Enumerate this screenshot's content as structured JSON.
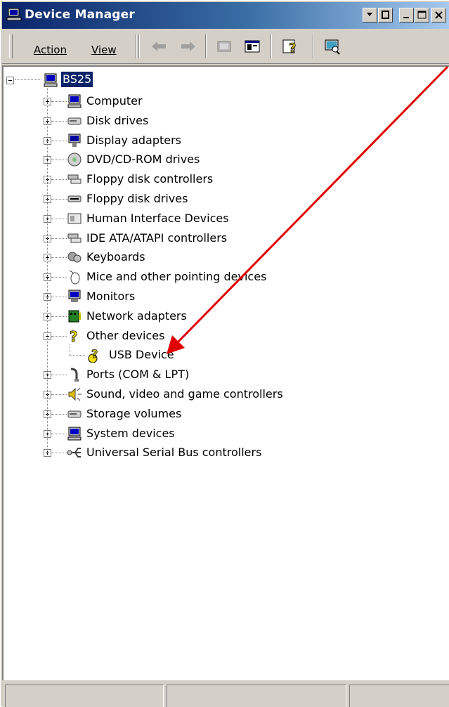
{
  "window": {
    "title": "Device Manager"
  },
  "menu": {
    "action": "Action",
    "view": "View"
  },
  "tree": {
    "root": "BS25",
    "items": [
      {
        "label": "Computer",
        "icon": "computer-icon"
      },
      {
        "label": "Disk drives",
        "icon": "disk-drive-icon"
      },
      {
        "label": "Display adapters",
        "icon": "display-adapter-icon"
      },
      {
        "label": "DVD/CD-ROM drives",
        "icon": "cd-drive-icon"
      },
      {
        "label": "Floppy disk controllers",
        "icon": "controller-icon"
      },
      {
        "label": "Floppy disk drives",
        "icon": "floppy-drive-icon"
      },
      {
        "label": "Human Interface Devices",
        "icon": "hid-icon"
      },
      {
        "label": "IDE ATA/ATAPI controllers",
        "icon": "controller-icon"
      },
      {
        "label": "Keyboards",
        "icon": "keyboard-icon"
      },
      {
        "label": "Mice and other pointing devices",
        "icon": "mouse-icon"
      },
      {
        "label": "Monitors",
        "icon": "monitor-icon"
      },
      {
        "label": "Network adapters",
        "icon": "network-adapter-icon"
      },
      {
        "label": "Other devices",
        "icon": "question-icon",
        "expanded": true,
        "children": [
          {
            "label": "USB Device",
            "icon": "unknown-device-icon"
          }
        ]
      },
      {
        "label": "Ports (COM & LPT)",
        "icon": "port-icon"
      },
      {
        "label": "Sound, video and game controllers",
        "icon": "sound-icon"
      },
      {
        "label": "Storage volumes",
        "icon": "disk-drive-icon"
      },
      {
        "label": "System devices",
        "icon": "computer-icon"
      },
      {
        "label": "Universal Serial Bus controllers",
        "icon": "usb-icon"
      }
    ]
  },
  "colors": {
    "title_gradient_start": "#0a246a",
    "title_gradient_end": "#a6caf0",
    "selection": "#0a246a",
    "annotation_arrow": "#e00000"
  }
}
